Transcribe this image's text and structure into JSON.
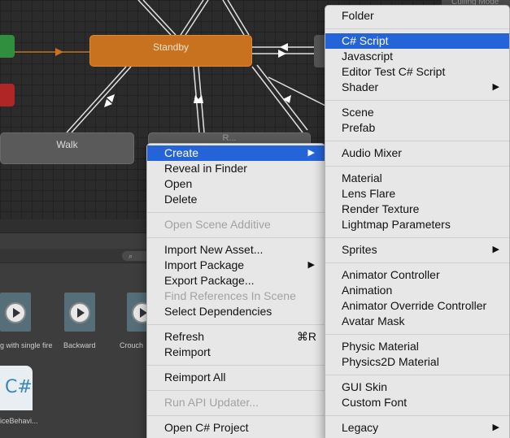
{
  "graph": {
    "standby_label": "Standby",
    "walk_label": "Walk",
    "run_label": "R...",
    "culling_label": "Culling Mode"
  },
  "panel": {
    "search_icon": "search-icon",
    "assets": [
      {
        "label": "g with single fire"
      },
      {
        "label": "Backward"
      },
      {
        "label": "Crouch"
      }
    ],
    "script_icon_text": "C#",
    "script_label": "iceBehavi..."
  },
  "main_menu": {
    "items": [
      {
        "label": "Create",
        "selected": true,
        "submenu": true
      },
      {
        "label": "Reveal in Finder"
      },
      {
        "label": "Open"
      },
      {
        "label": "Delete"
      },
      {
        "label": "Open Scene Additive",
        "disabled": true
      },
      {
        "label": "Import New Asset..."
      },
      {
        "label": "Import Package",
        "submenu": true
      },
      {
        "label": "Export Package..."
      },
      {
        "label": "Find References In Scene",
        "disabled": true
      },
      {
        "label": "Select Dependencies"
      },
      {
        "label": "Refresh",
        "shortcut": "⌘R"
      },
      {
        "label": "Reimport"
      },
      {
        "label": "Reimport All"
      },
      {
        "label": "Run API Updater...",
        "disabled": true
      },
      {
        "label": "Open C# Project"
      }
    ]
  },
  "create_menu": {
    "items": [
      {
        "label": "Folder"
      },
      {
        "label": "C# Script",
        "selected": true
      },
      {
        "label": "Javascript"
      },
      {
        "label": "Editor Test C# Script"
      },
      {
        "label": "Shader",
        "submenu": true
      },
      {
        "label": "Scene"
      },
      {
        "label": "Prefab"
      },
      {
        "label": "Audio Mixer"
      },
      {
        "label": "Material"
      },
      {
        "label": "Lens Flare"
      },
      {
        "label": "Render Texture"
      },
      {
        "label": "Lightmap Parameters"
      },
      {
        "label": "Sprites",
        "submenu": true
      },
      {
        "label": "Animator Controller"
      },
      {
        "label": "Animation"
      },
      {
        "label": "Animator Override Controller"
      },
      {
        "label": "Avatar Mask"
      },
      {
        "label": "Physic Material"
      },
      {
        "label": "Physics2D Material"
      },
      {
        "label": "GUI Skin"
      },
      {
        "label": "Custom Font"
      },
      {
        "label": "Legacy",
        "submenu": true
      }
    ]
  },
  "colors": {
    "selection": "#2464d8",
    "standby_node": "#c8711f",
    "menu_bg": "#e7e7e7"
  }
}
